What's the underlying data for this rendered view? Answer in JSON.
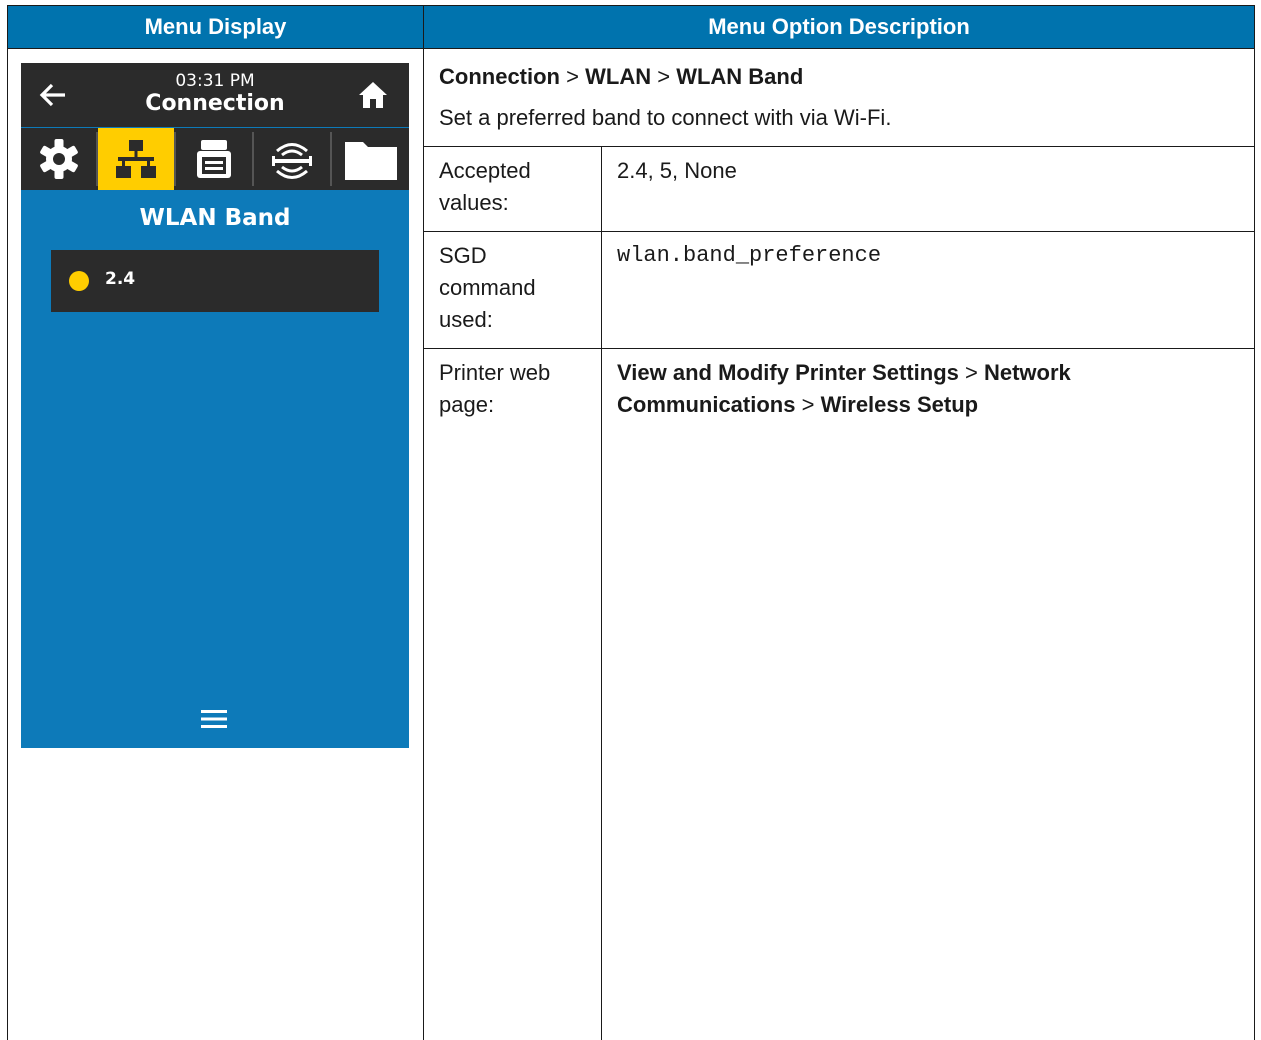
{
  "headers": {
    "left": "Menu Display",
    "right": "Menu Option Description"
  },
  "device": {
    "time": "03:31 PM",
    "title": "Connection",
    "section": "WLAN Band",
    "option": "2.4",
    "icons": [
      "back-arrow-icon",
      "home-icon",
      "gear-icon",
      "network-icon",
      "printer-icon",
      "wireless-icon",
      "folder-icon",
      "menu-icon"
    ],
    "colors": {
      "screen": "#0d7ab9",
      "bar": "#2b2b2b",
      "accent": "#ffcd00"
    }
  },
  "path": {
    "p1": "Connection",
    "p2": "WLAN",
    "p3": "WLAN Band",
    "sep": ">"
  },
  "description": "Set a preferred band to connect with via Wi-Fi.",
  "rows": {
    "accepted_label": "Accepted values:",
    "accepted_value": "2.4, 5, None",
    "sgd_label": "SGD command used:",
    "sgd_value": "wlan.band_preference",
    "web_label": "Printer web page:",
    "web_p1": "View and Modify Printer Settings",
    "web_p2": "Network Communications",
    "web_p3": "Wireless Setup"
  },
  "header_color": "#0073ae"
}
